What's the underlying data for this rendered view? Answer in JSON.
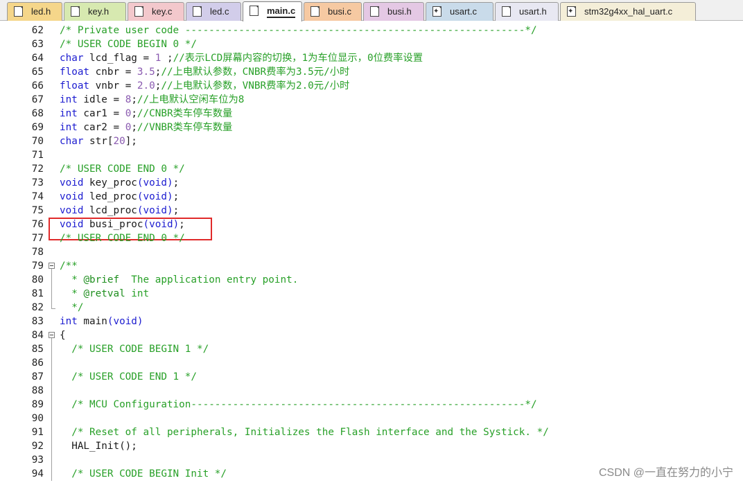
{
  "tabs": [
    {
      "label": "led.h",
      "color": "#f5d68a",
      "icon": "file-icon"
    },
    {
      "label": "key.h",
      "color": "#d7e9b0",
      "icon": "file-icon"
    },
    {
      "label": "key.c",
      "color": "#f3c8cc",
      "icon": "file-icon"
    },
    {
      "label": "led.c",
      "color": "#d2cdea",
      "icon": "file-icon"
    },
    {
      "label": "main.c",
      "color": "#ffffff",
      "icon": "file-icon",
      "active": true
    },
    {
      "label": "busi.c",
      "color": "#f6c9a2",
      "icon": "file-icon"
    },
    {
      "label": "busi.h",
      "color": "#e4c8e4",
      "icon": "file-icon"
    },
    {
      "label": "usart.c",
      "color": "#c9dbea",
      "icon": "dll-file-icon"
    },
    {
      "label": "usart.h",
      "color": "#e8e8f2",
      "icon": "file-icon"
    },
    {
      "label": "stm32g4xx_hal_uart.c",
      "color": "#f4eed8",
      "icon": "dll-file-icon"
    }
  ],
  "code_lines": [
    {
      "num": "62",
      "tokens": [
        [
          "c",
          "/* Private user code ---------------------------------------------------------*/"
        ]
      ]
    },
    {
      "num": "63",
      "tokens": [
        [
          "c",
          "/* USER CODE BEGIN 0 */"
        ]
      ]
    },
    {
      "num": "64",
      "tokens": [
        [
          "k",
          "char"
        ],
        [
          "i",
          " lcd_flag = "
        ],
        [
          "n",
          "1"
        ],
        [
          "i",
          " ;"
        ],
        [
          "c",
          "//表示LCD屏幕内容的切换，1为车位显示，0位费率设置"
        ]
      ]
    },
    {
      "num": "65",
      "tokens": [
        [
          "k",
          "float"
        ],
        [
          "i",
          " cnbr = "
        ],
        [
          "n",
          "3.5"
        ],
        [
          "i",
          ";"
        ],
        [
          "c",
          "//上电默认参数，CNBR费率为3.5元/小时"
        ]
      ]
    },
    {
      "num": "66",
      "tokens": [
        [
          "k",
          "float"
        ],
        [
          "i",
          " vnbr = "
        ],
        [
          "n",
          "2.0"
        ],
        [
          "i",
          ";"
        ],
        [
          "c",
          "//上电默认参数，VNBR费率为2.0元/小时"
        ]
      ]
    },
    {
      "num": "67",
      "tokens": [
        [
          "k",
          "int"
        ],
        [
          "i",
          " idle = "
        ],
        [
          "n",
          "8"
        ],
        [
          "i",
          ";"
        ],
        [
          "c",
          "//上电默认空闲车位为8"
        ]
      ]
    },
    {
      "num": "68",
      "tokens": [
        [
          "k",
          "int"
        ],
        [
          "i",
          " car1 = "
        ],
        [
          "n",
          "0"
        ],
        [
          "i",
          ";"
        ],
        [
          "c",
          "//CNBR类车停车数量"
        ]
      ]
    },
    {
      "num": "69",
      "tokens": [
        [
          "k",
          "int"
        ],
        [
          "i",
          " car2 = "
        ],
        [
          "n",
          "0"
        ],
        [
          "i",
          ";"
        ],
        [
          "c",
          "//VNBR类车停车数量"
        ]
      ]
    },
    {
      "num": "70",
      "tokens": [
        [
          "k",
          "char"
        ],
        [
          "i",
          " str["
        ],
        [
          "n",
          "20"
        ],
        [
          "i",
          "];"
        ]
      ]
    },
    {
      "num": "71",
      "tokens": []
    },
    {
      "num": "72",
      "tokens": [
        [
          "c",
          "/* USER CODE END 0 */"
        ]
      ]
    },
    {
      "num": "73",
      "tokens": [
        [
          "k",
          "void"
        ],
        [
          "i",
          " key_proc"
        ],
        [
          "p",
          "("
        ],
        [
          "k",
          "void"
        ],
        [
          "p",
          ")"
        ],
        [
          "i",
          ";"
        ]
      ]
    },
    {
      "num": "74",
      "tokens": [
        [
          "k",
          "void"
        ],
        [
          "i",
          " led_proc"
        ],
        [
          "p",
          "("
        ],
        [
          "k",
          "void"
        ],
        [
          "p",
          ")"
        ],
        [
          "i",
          ";"
        ]
      ]
    },
    {
      "num": "75",
      "tokens": [
        [
          "k",
          "void"
        ],
        [
          "i",
          " lcd_proc"
        ],
        [
          "p",
          "("
        ],
        [
          "k",
          "void"
        ],
        [
          "p",
          ")"
        ],
        [
          "i",
          ";"
        ]
      ]
    },
    {
      "num": "76",
      "tokens": [
        [
          "k",
          "void"
        ],
        [
          "i",
          " busi_proc"
        ],
        [
          "p",
          "("
        ],
        [
          "k",
          "void"
        ],
        [
          "p",
          ")"
        ],
        [
          "i",
          ";"
        ]
      ]
    },
    {
      "num": "77",
      "tokens": [
        [
          "c",
          "/* USER CODE END 0 */"
        ]
      ]
    },
    {
      "num": "78",
      "tokens": []
    },
    {
      "num": "79",
      "fold": "start",
      "tokens": [
        [
          "c",
          "/**"
        ]
      ]
    },
    {
      "num": "80",
      "fold": "mid",
      "tokens": [
        [
          "c",
          "  * "
        ],
        [
          "d",
          "@brief"
        ],
        [
          "c",
          "  The application entry point."
        ]
      ]
    },
    {
      "num": "81",
      "fold": "mid",
      "tokens": [
        [
          "c",
          "  * "
        ],
        [
          "d",
          "@retval"
        ],
        [
          "c",
          " int"
        ]
      ]
    },
    {
      "num": "82",
      "fold": "end",
      "tokens": [
        [
          "c",
          "  */"
        ]
      ]
    },
    {
      "num": "83",
      "tokens": [
        [
          "k",
          "int"
        ],
        [
          "i",
          " main"
        ],
        [
          "p",
          "("
        ],
        [
          "k",
          "void"
        ],
        [
          "p",
          ")"
        ]
      ]
    },
    {
      "num": "84",
      "fold": "start",
      "tokens": [
        [
          "i",
          "{"
        ]
      ]
    },
    {
      "num": "85",
      "fold": "mid",
      "tokens": [
        [
          "i",
          "  "
        ],
        [
          "c",
          "/* USER CODE BEGIN 1 */"
        ]
      ]
    },
    {
      "num": "86",
      "fold": "mid",
      "tokens": []
    },
    {
      "num": "87",
      "fold": "mid",
      "tokens": [
        [
          "i",
          "  "
        ],
        [
          "c",
          "/* USER CODE END 1 */"
        ]
      ]
    },
    {
      "num": "88",
      "fold": "mid",
      "tokens": []
    },
    {
      "num": "89",
      "fold": "mid",
      "tokens": [
        [
          "i",
          "  "
        ],
        [
          "c",
          "/* MCU Configuration--------------------------------------------------------*/"
        ]
      ]
    },
    {
      "num": "90",
      "fold": "mid",
      "tokens": []
    },
    {
      "num": "91",
      "fold": "mid",
      "tokens": [
        [
          "i",
          "  "
        ],
        [
          "c",
          "/* Reset of all peripherals, Initializes the Flash interface and the Systick. */"
        ]
      ]
    },
    {
      "num": "92",
      "fold": "mid",
      "tokens": [
        [
          "i",
          "  HAL_Init();"
        ]
      ]
    },
    {
      "num": "93",
      "fold": "mid",
      "tokens": []
    },
    {
      "num": "94",
      "fold": "mid",
      "tokens": [
        [
          "i",
          "  "
        ],
        [
          "c",
          "/* USER CODE BEGIN Init */"
        ]
      ]
    }
  ],
  "watermark": "CSDN @一直在努力的小宁"
}
